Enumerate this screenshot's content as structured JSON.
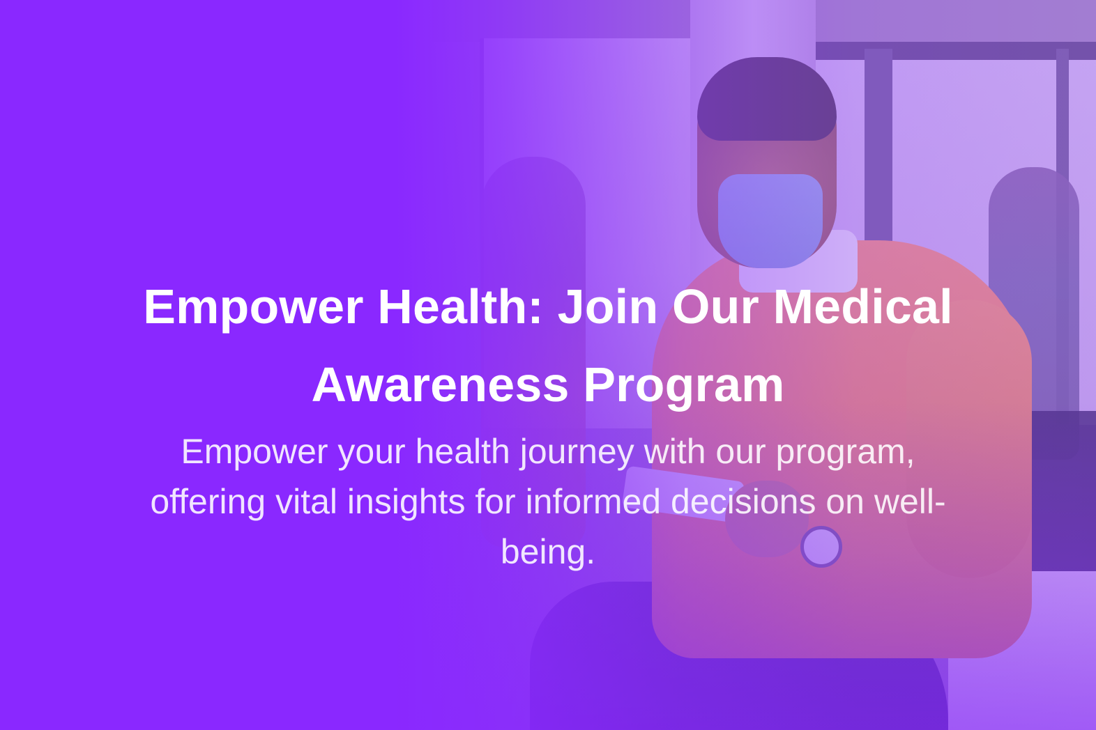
{
  "hero": {
    "title": "Empower Health: Join Our Medical Awareness Program",
    "subtitle": "Empower your health journey with our program, offering vital insights for informed decisions on well-being.",
    "overlay_color": "#8A28FF"
  }
}
